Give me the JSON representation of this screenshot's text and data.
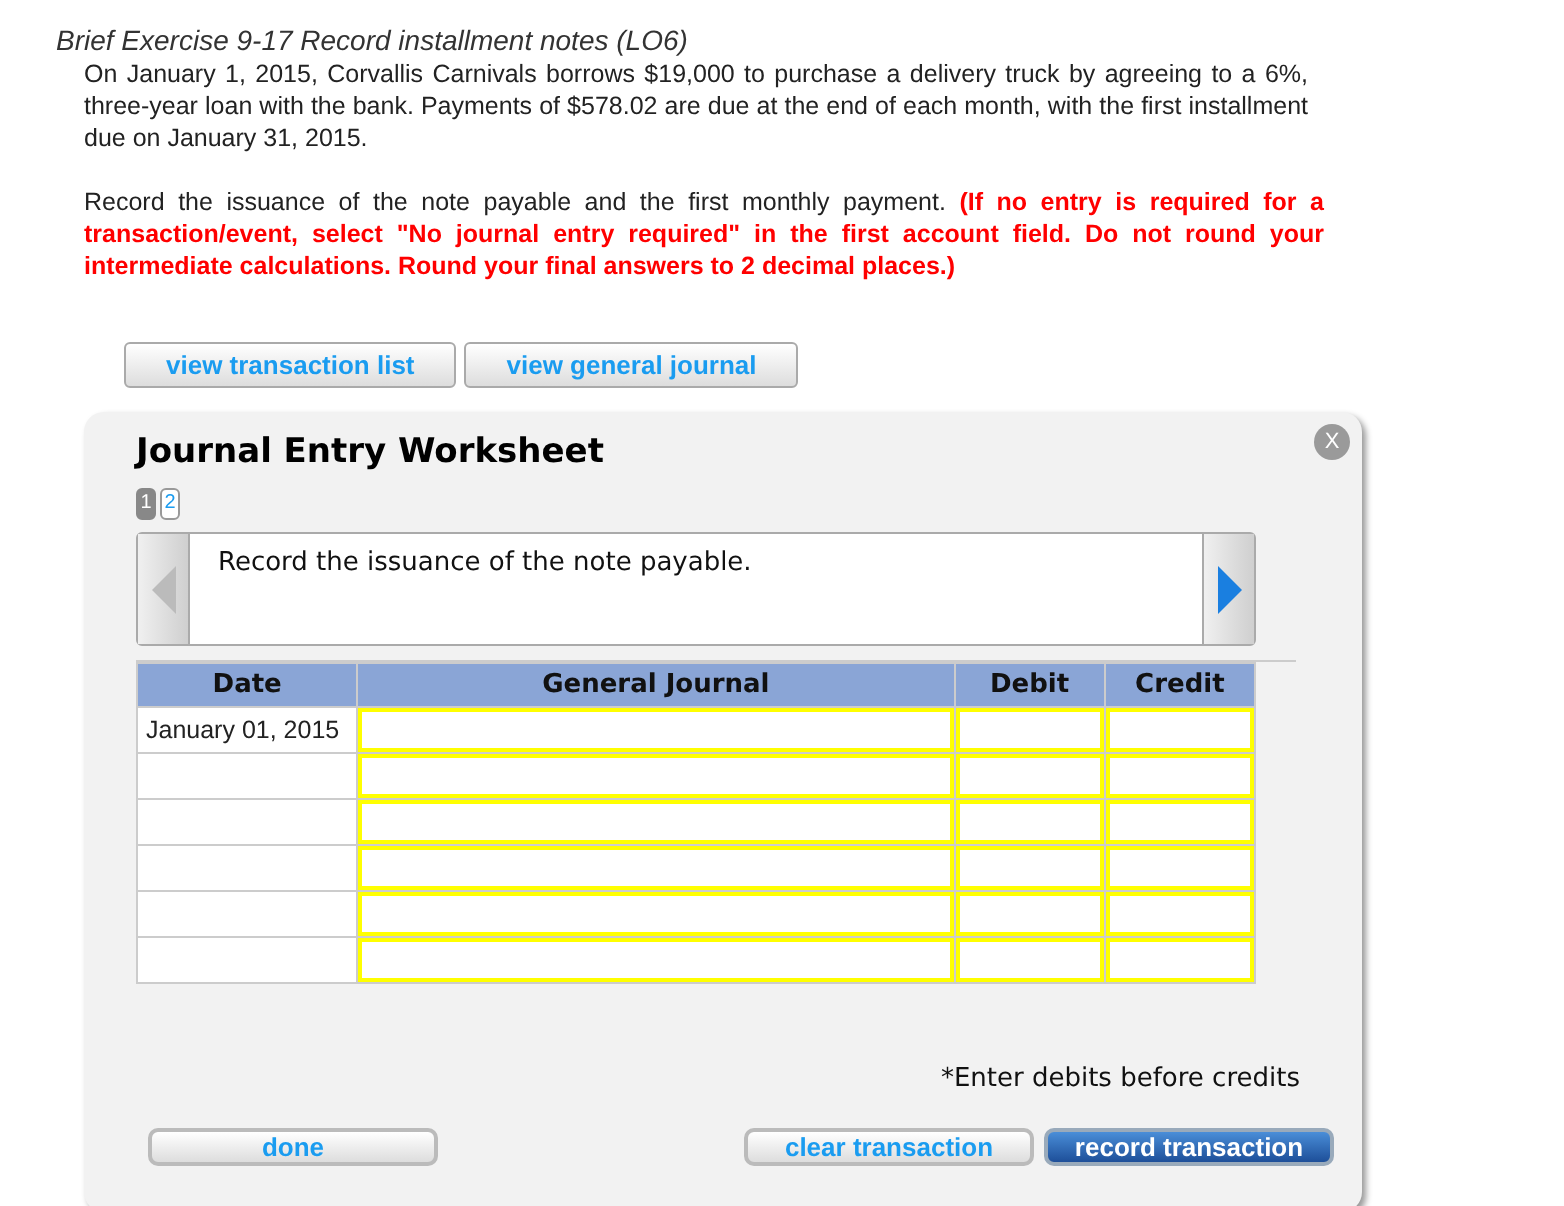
{
  "exercise_title": "Brief Exercise 9-17 Record installment notes (LO6)",
  "problem": "On January 1, 2015, Corvallis Carnivals borrows $19,000 to purchase a delivery truck by agreeing to a 6%, three-year loan with the bank. Payments of $578.02 are due at the end of each month, with the first installment due on January 31, 2015.",
  "instruction": "Record the issuance of the note payable and the first monthly payment. **(If no entry is required for a transaction/event, select \"No journal entry required\" in the first account field. Do not round your intermediate calculations. Round your final answers to 2 decimal places.)**",
  "view_buttons": [
    "view transaction list",
    "view general journal"
  ],
  "worksheet": {
    "title": "Journal Entry Worksheet",
    "close": "X",
    "pages": [
      {
        "label": "1",
        "selected": true
      },
      {
        "label": "2",
        "selected": false
      }
    ],
    "prev": {
      "disabled": true
    },
    "next": {
      "disabled": false
    },
    "prompt": "Record the issuance of the note payable.",
    "columns": [
      "Date",
      "General Journal",
      "Debit",
      "Credit"
    ],
    "rows": [
      {
        "date": "January 01, 2015"
      },
      {},
      {},
      {},
      {},
      {}
    ],
    "note": "*Enter debits before credits",
    "buttons": [
      {
        "label": "done",
        "kind": "plain"
      },
      {
        "label": "clear transaction",
        "kind": "plain"
      },
      {
        "label": "record transaction",
        "kind": "primary"
      }
    ]
  }
}
